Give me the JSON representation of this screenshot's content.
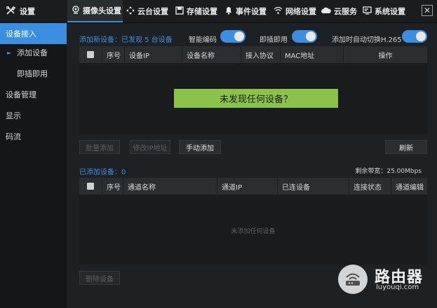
{
  "app": {
    "title": "设置"
  },
  "tabs": [
    {
      "label": "摄像头设置",
      "icon": "camera-icon",
      "active": true
    },
    {
      "label": "云台设置",
      "icon": "ptz-icon"
    },
    {
      "label": "存储设置",
      "icon": "storage-icon"
    },
    {
      "label": "事件设置",
      "icon": "bell-icon"
    },
    {
      "label": "网络设置",
      "icon": "wifi-icon"
    },
    {
      "label": "云服务",
      "icon": "cloud-icon"
    },
    {
      "label": "系统设置",
      "icon": "monitor-icon"
    }
  ],
  "close_label": "✕",
  "sidebar": {
    "items": [
      {
        "label": "设备接入",
        "active": true
      },
      {
        "label": "添加设备"
      },
      {
        "label": "即插即用"
      },
      {
        "label": "设备管理"
      },
      {
        "label": "显示"
      },
      {
        "label": "码流"
      }
    ]
  },
  "add_section": {
    "label": "添加新设备：已发现 5 台设备",
    "toggles": [
      {
        "label": "智能编码",
        "on": true
      },
      {
        "label": "即插即用",
        "on": true
      },
      {
        "label": "添加时自动切换H.265",
        "on": true
      }
    ],
    "columns": [
      "",
      "序号",
      "设备IP",
      "设备名称",
      "接入协议",
      "MAC地址",
      "操作"
    ],
    "notice": "未发现任何设备？",
    "buttons": {
      "batch_add": "批量添加",
      "modify_ip": "修改IP地址",
      "manual_add": "手动添加",
      "refresh": "刷新"
    }
  },
  "added_section": {
    "label": "已添加设备：0",
    "bandwidth": "剩余带宽：25.00Mbps",
    "columns": [
      "",
      "序号",
      "通道名称",
      "通道IP",
      "已连设备",
      "连接状态",
      "通道编辑"
    ],
    "empty_text": "未添加任何设备",
    "buttons": {
      "delete": "删除设备"
    }
  },
  "watermark": {
    "name": "路由器",
    "url": "luyouqi.com"
  },
  "colors": {
    "accent": "#3b8fe0",
    "notice_bg": "#8bc34a",
    "background": "#1e2124"
  }
}
